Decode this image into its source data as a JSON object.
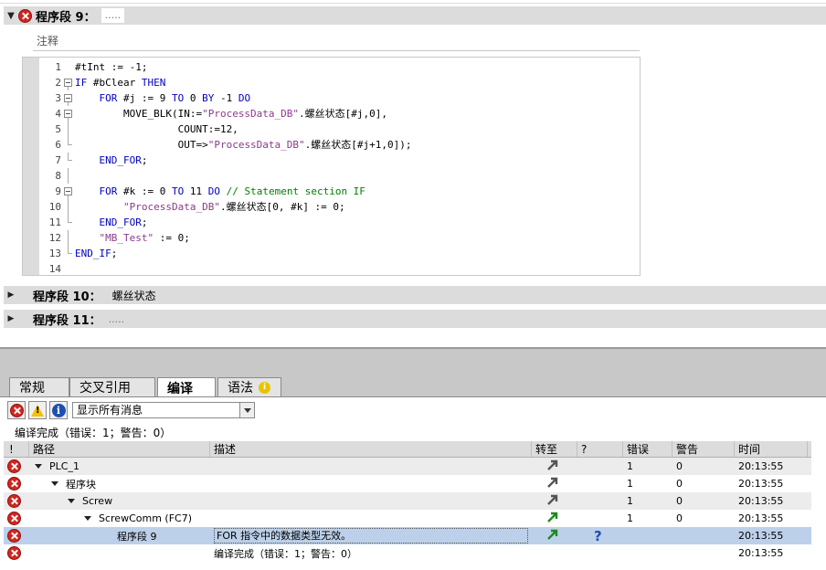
{
  "editor": {
    "network9": {
      "title": "程序段 9：",
      "comment": "",
      "dots": "....."
    },
    "comment_label": "注释",
    "code": [
      {
        "n": "1",
        "fold": "none",
        "parts": [
          [
            "sym",
            "#tInt := -1;"
          ]
        ]
      },
      {
        "n": "2",
        "fold": "open",
        "parts": [
          [
            "kw",
            "IF"
          ],
          [
            "sym",
            " #bClear "
          ],
          [
            "kw",
            "THEN"
          ]
        ]
      },
      {
        "n": "3",
        "fold": "open",
        "parts": [
          [
            "sym",
            "    "
          ],
          [
            "kw",
            "FOR"
          ],
          [
            "sym",
            " #j := 9 "
          ],
          [
            "kw",
            "TO"
          ],
          [
            "sym",
            " 0 "
          ],
          [
            "kw",
            "BY"
          ],
          [
            "sym",
            " -1 "
          ],
          [
            "kw",
            "DO"
          ]
        ]
      },
      {
        "n": "4",
        "fold": "open",
        "parts": [
          [
            "sym",
            "        MOVE_BLK(IN:="
          ],
          [
            "str",
            "\"ProcessData_DB\""
          ],
          [
            "sym",
            "."
          ],
          [
            "zh",
            "螺丝状态"
          ],
          [
            "sym",
            "[#j,0],"
          ]
        ]
      },
      {
        "n": "5",
        "fold": "line",
        "parts": [
          [
            "sym",
            "                 COUNT:=12,"
          ]
        ]
      },
      {
        "n": "6",
        "fold": "end",
        "parts": [
          [
            "sym",
            "                 OUT=>"
          ],
          [
            "str",
            "\"ProcessData_DB\""
          ],
          [
            "sym",
            "."
          ],
          [
            "zh",
            "螺丝状态"
          ],
          [
            "sym",
            "[#j+1,0]);"
          ]
        ]
      },
      {
        "n": "7",
        "fold": "end",
        "parts": [
          [
            "sym",
            "    "
          ],
          [
            "kw",
            "END_FOR"
          ],
          [
            "sym",
            ";"
          ]
        ]
      },
      {
        "n": "8",
        "fold": "line",
        "parts": []
      },
      {
        "n": "9",
        "fold": "open",
        "parts": [
          [
            "sym",
            "    "
          ],
          [
            "kw",
            "FOR"
          ],
          [
            "sym",
            " #k := 0 "
          ],
          [
            "kw",
            "TO"
          ],
          [
            "sym",
            " 11 "
          ],
          [
            "kw",
            "DO"
          ],
          [
            "sym",
            " "
          ],
          [
            "cmt",
            "// Statement section IF"
          ]
        ]
      },
      {
        "n": "10",
        "fold": "line",
        "parts": [
          [
            "sym",
            "        "
          ],
          [
            "str",
            "\"ProcessData_DB\""
          ],
          [
            "sym",
            "."
          ],
          [
            "zh",
            "螺丝状态"
          ],
          [
            "sym",
            "[0, #k] := 0;"
          ]
        ]
      },
      {
        "n": "11",
        "fold": "end",
        "parts": [
          [
            "sym",
            "    "
          ],
          [
            "kw",
            "END_FOR"
          ],
          [
            "sym",
            ";"
          ]
        ]
      },
      {
        "n": "12",
        "fold": "line",
        "parts": [
          [
            "sym",
            "    "
          ],
          [
            "str",
            "\"MB_Test\""
          ],
          [
            "sym",
            " := 0;"
          ]
        ]
      },
      {
        "n": "13",
        "fold": "end",
        "parts": [
          [
            "kw",
            "END_IF"
          ],
          [
            "sym",
            ";"
          ]
        ]
      },
      {
        "n": "14",
        "fold": "none",
        "parts": []
      }
    ],
    "network10": {
      "title": "程序段 10：",
      "comment": "螺丝状态"
    },
    "network11": {
      "title": "程序段 11：",
      "dots": "....."
    }
  },
  "inspector": {
    "tabs": [
      {
        "label": "常规",
        "active": false
      },
      {
        "label": "交叉引用",
        "active": false
      },
      {
        "label": "编译",
        "active": true
      },
      {
        "label": "语法",
        "active": false,
        "badge": "i"
      }
    ],
    "filter": {
      "selected": "显示所有消息"
    },
    "status": "编译完成（错误：1；警告：0）",
    "columns": {
      "bang": "!",
      "path": "路径",
      "desc": "描述",
      "goto": "转至",
      "q": "?",
      "errors": "错误",
      "warnings": "警告",
      "time": "时间"
    },
    "rows": [
      {
        "indent": 0,
        "arrow": true,
        "path": "PLC_1",
        "desc": "",
        "goto": "gray",
        "q": "",
        "errors": "1",
        "warnings": "0",
        "time": "20:13:55",
        "style": "alt"
      },
      {
        "indent": 1,
        "arrow": true,
        "path": "程序块",
        "desc": "",
        "goto": "gray",
        "q": "",
        "errors": "1",
        "warnings": "0",
        "time": "20:13:55",
        "style": ""
      },
      {
        "indent": 2,
        "arrow": true,
        "path": "Screw",
        "desc": "",
        "goto": "gray",
        "q": "",
        "errors": "1",
        "warnings": "0",
        "time": "20:13:55",
        "style": "alt"
      },
      {
        "indent": 3,
        "arrow": true,
        "path": "ScrewComm (FC7)",
        "desc": "",
        "goto": "green",
        "q": "",
        "errors": "1",
        "warnings": "0",
        "time": "20:13:55",
        "style": ""
      },
      {
        "indent": 5,
        "arrow": false,
        "path": "程序段 9",
        "desc": "FOR 指令中的数据类型无效。",
        "goto": "green",
        "q": "?",
        "errors": "",
        "warnings": "",
        "time": "20:13:55",
        "style": "sel"
      },
      {
        "indent": 0,
        "arrow": false,
        "path": "",
        "desc": "编译完成（错误：1；警告：0）",
        "goto": "",
        "q": "",
        "errors": "",
        "warnings": "",
        "time": "20:13:55",
        "style": ""
      }
    ]
  },
  "colors": {
    "error": "#d0261f",
    "selection": "#bcd0ea",
    "keyword": "#0000c0",
    "string": "#8b3a8b",
    "comment": "#008000"
  }
}
